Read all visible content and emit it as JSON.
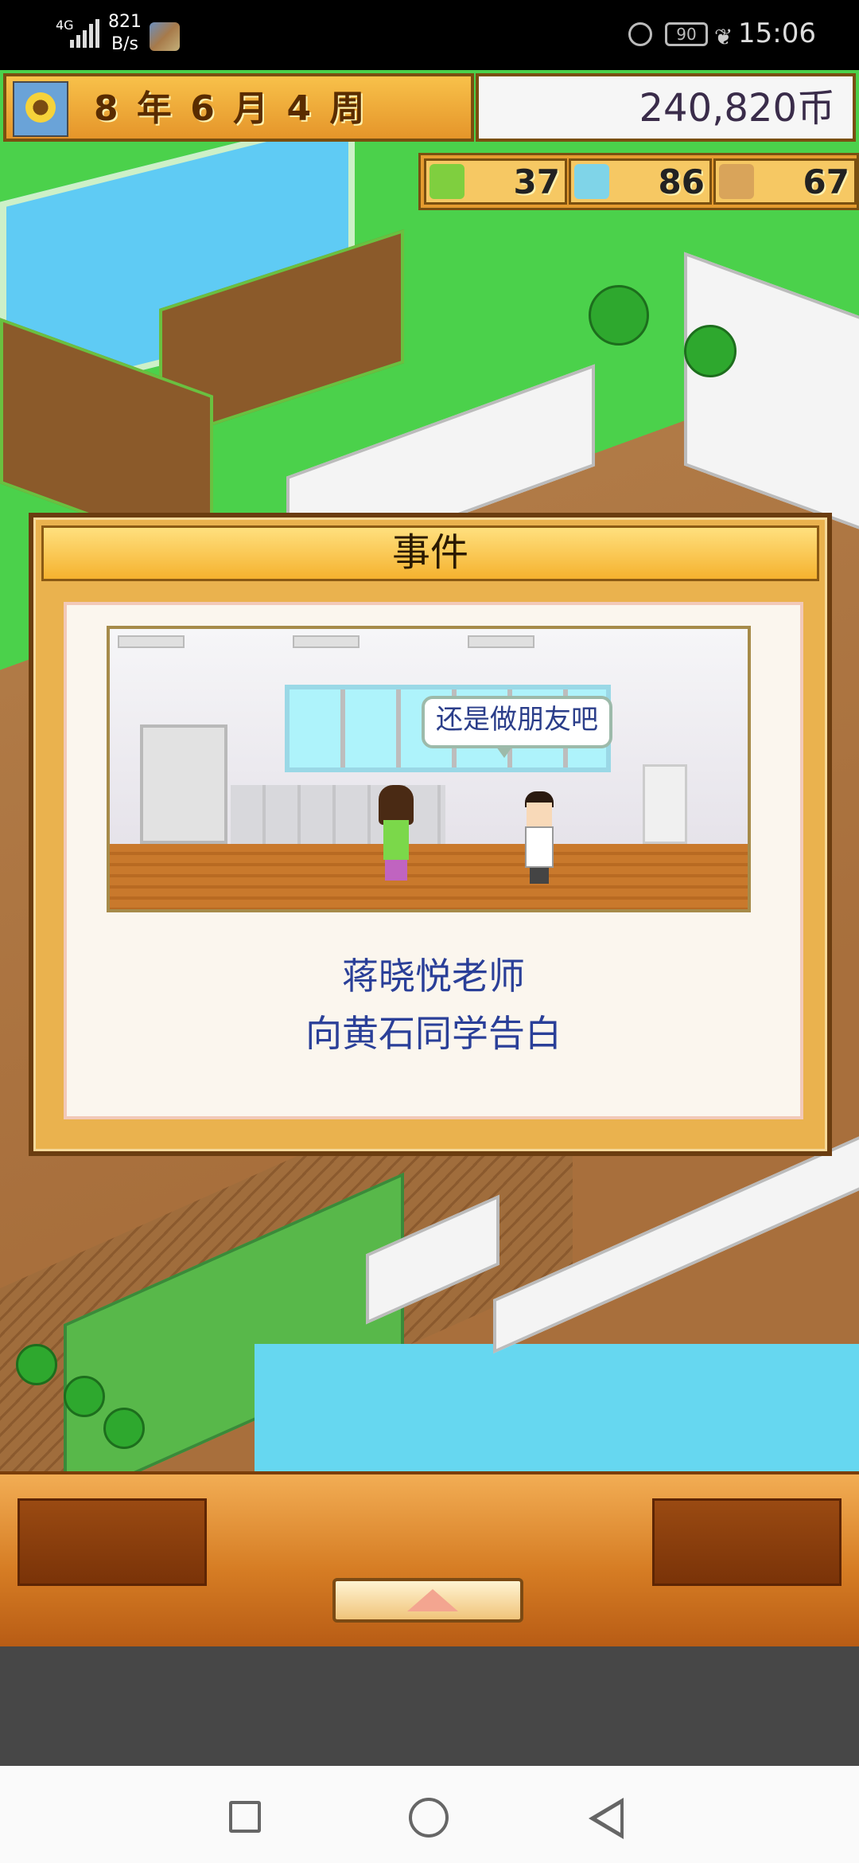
{
  "status_bar": {
    "network_type": "4G",
    "net_speed_value": "821",
    "net_speed_unit": "B/s",
    "battery": "90",
    "time": "15:06",
    "icons": [
      "signal-icon",
      "app-thumbnail-icon",
      "alarm-icon",
      "battery-icon",
      "leaf-icon"
    ]
  },
  "hud": {
    "date": "8 年 6 月 4 周",
    "money": "240,820币",
    "stats": [
      {
        "icon": "pencil-icon",
        "value": "37"
      },
      {
        "icon": "flask-icon",
        "value": "86"
      },
      {
        "icon": "statue-icon",
        "value": "67"
      }
    ]
  },
  "dialog": {
    "title": "事件",
    "speech_bubble": "还是做朋友吧",
    "message_line1": "蒋晓悦老师",
    "message_line2": "向黄石同学告白"
  },
  "colors": {
    "hud_orange": "#e59b2f",
    "dialog_text": "#2a3f98",
    "water": "#69d8f0"
  }
}
